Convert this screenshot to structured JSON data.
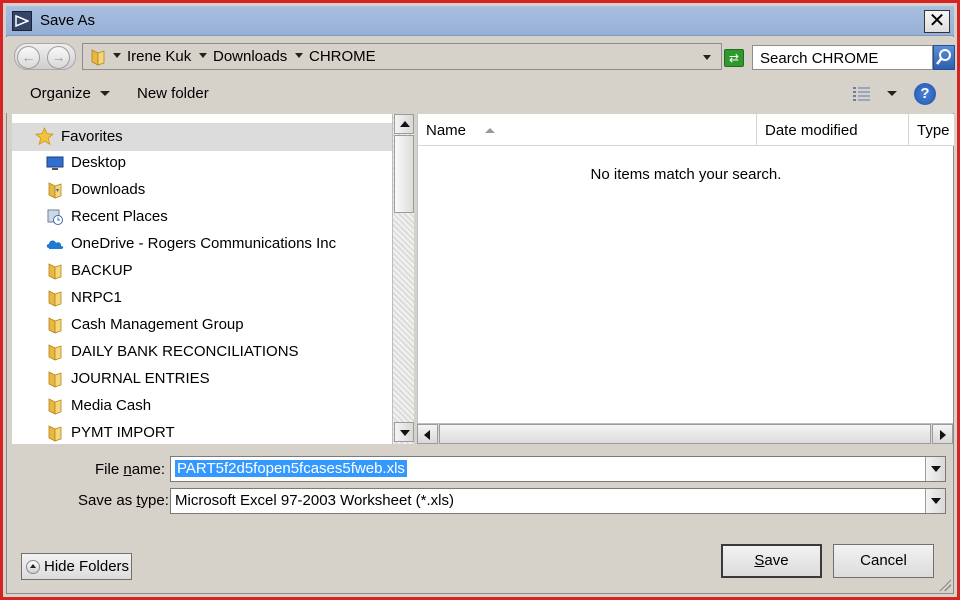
{
  "window": {
    "title": "Save As",
    "close_glyph": "✕",
    "border_color": "#d62424"
  },
  "address_bar": {
    "back_glyph": "←",
    "forward_glyph": "→",
    "breadcrumbs": [
      "Irene Kuk",
      "Downloads",
      "CHROME"
    ],
    "search_placeholder": "Search CHROME"
  },
  "toolbar": {
    "organize_label": "Organize",
    "new_folder_label": "New folder",
    "help_glyph": "?"
  },
  "nav_pane": {
    "favorites_label": "Favorites",
    "items": [
      {
        "label": "Desktop",
        "icon": "desktop-icon"
      },
      {
        "label": "Downloads",
        "icon": "downloads-folder-icon"
      },
      {
        "label": "Recent Places",
        "icon": "recent-places-icon"
      },
      {
        "label": "OneDrive - Rogers Communications Inc",
        "icon": "onedrive-icon"
      },
      {
        "label": "BACKUP",
        "icon": "folder-icon"
      },
      {
        "label": "NRPC1",
        "icon": "folder-icon"
      },
      {
        "label": "Cash Management Group",
        "icon": "folder-icon"
      },
      {
        "label": "DAILY BANK RECONCILIATIONS",
        "icon": "folder-icon"
      },
      {
        "label": "JOURNAL ENTRIES",
        "icon": "folder-icon"
      },
      {
        "label": "Media Cash",
        "icon": "folder-icon"
      },
      {
        "label": "PYMT IMPORT",
        "icon": "folder-icon"
      }
    ]
  },
  "file_pane": {
    "columns": [
      "Name",
      "Date modified",
      "Type"
    ],
    "empty_message": "No items match your search."
  },
  "form": {
    "file_name_label_pre": "File ",
    "file_name_label_ul": "n",
    "file_name_label_post": "ame:",
    "file_name_value": "PART5f2d5fopen5fcases5fweb.xls",
    "save_type_label_pre": "Save as ",
    "save_type_label_ul": "t",
    "save_type_label_post": "ype:",
    "save_type_value": "Microsoft Excel 97-2003 Worksheet (*.xls)"
  },
  "buttons": {
    "hide_folders": "Hide Folders",
    "save_ul": "S",
    "save_rest": "ave",
    "cancel": "Cancel"
  }
}
